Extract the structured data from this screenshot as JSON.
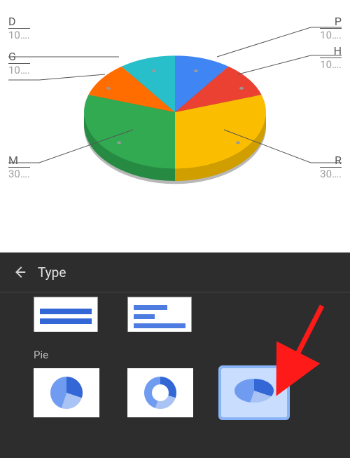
{
  "chart_data": {
    "type": "pie",
    "title": "",
    "series": [
      {
        "name": "P",
        "value": 10,
        "label": "10….",
        "color": "#3f85f4"
      },
      {
        "name": "H",
        "value": 10,
        "label": "10….",
        "color": "#eb4132"
      },
      {
        "name": "R",
        "value": 30,
        "label": "30….",
        "color": "#fbbd00"
      },
      {
        "name": "M",
        "value": 30,
        "label": "30….",
        "color": "#31aa52"
      },
      {
        "name": "G",
        "value": 10,
        "label": "10….",
        "color": "#ff6d01"
      },
      {
        "name": "D",
        "value": 10,
        "label": "10….",
        "color": "#28bfca"
      }
    ],
    "style_3d": true
  },
  "labels": {
    "D": {
      "letter": "D",
      "val": "10…."
    },
    "G": {
      "letter": "G",
      "val": "10…."
    },
    "M": {
      "letter": "M",
      "val": "30…."
    },
    "P": {
      "letter": "P",
      "val": "10…."
    },
    "H": {
      "letter": "H",
      "val": "10…."
    },
    "R": {
      "letter": "R",
      "val": "30…."
    }
  },
  "panel": {
    "title": "Type",
    "section_pie": "Pie",
    "options": {
      "bar1": "bar-100",
      "bar2": "bar-grouped",
      "pie_flat": "pie-flat",
      "pie_donut": "pie-donut",
      "pie_3d": "pie-3d"
    },
    "selected": "pie-3d"
  }
}
